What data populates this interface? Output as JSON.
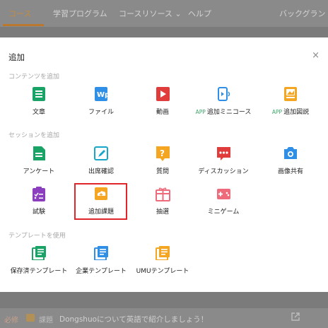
{
  "background": {
    "nav": [
      "コース",
      "学習プログラム",
      "コースリソース ⌄",
      "ヘルプ",
      "バックグラント"
    ],
    "bottom": {
      "required": "必修",
      "type": "課題",
      "title": "Dongshuoについて英語で紹介しましょう！"
    }
  },
  "modal": {
    "title": "追加",
    "close": "×",
    "sections": [
      {
        "label": "コンテンツを追加",
        "items": [
          {
            "label": "文章",
            "icon": "document-icon",
            "color": "#1aa366"
          },
          {
            "label": "ファイル",
            "icon": "wp-file-icon",
            "color": "#2f8fe6"
          },
          {
            "label": "動画",
            "icon": "video-play-icon",
            "color": "#e03c3c"
          },
          {
            "label": "追加ミニコース",
            "badge": "APP",
            "icon": "mini-course-icon",
            "color": "#2f8fe6"
          },
          {
            "label": "追加図説",
            "badge": "APP",
            "icon": "illustration-icon",
            "color": "#f4a623"
          }
        ]
      },
      {
        "label": "セッションを追加",
        "items": [
          {
            "label": "アンケート",
            "icon": "survey-icon",
            "color": "#1aa366"
          },
          {
            "label": "出席確認",
            "icon": "attendance-icon",
            "color": "#16a6c8"
          },
          {
            "label": "質問",
            "icon": "question-icon",
            "color": "#f4a623"
          },
          {
            "label": "ディスカッション",
            "icon": "discussion-icon",
            "color": "#e03c3c"
          },
          {
            "label": "画像共有",
            "icon": "camera-icon",
            "color": "#2f8fe6"
          },
          {
            "label": "試験",
            "icon": "exam-icon",
            "color": "#8b3fbf"
          },
          {
            "label": "追加課題",
            "icon": "assignment-icon",
            "color": "#f4a623"
          },
          {
            "label": "抽選",
            "icon": "lottery-icon",
            "color": "#ee6b7b"
          },
          {
            "label": "ミニゲーム",
            "icon": "game-icon",
            "color": "#ee6b7b"
          }
        ]
      },
      {
        "label": "テンプレートを使用",
        "items": [
          {
            "label": "保存済テンプレート",
            "icon": "saved-template-icon",
            "color": "#1aa366"
          },
          {
            "label": "企業テンプレート",
            "icon": "company-template-icon",
            "color": "#2f8fe6"
          },
          {
            "label": "UMUテンプレート",
            "icon": "umu-template-icon",
            "color": "#f4a623"
          }
        ]
      }
    ]
  }
}
